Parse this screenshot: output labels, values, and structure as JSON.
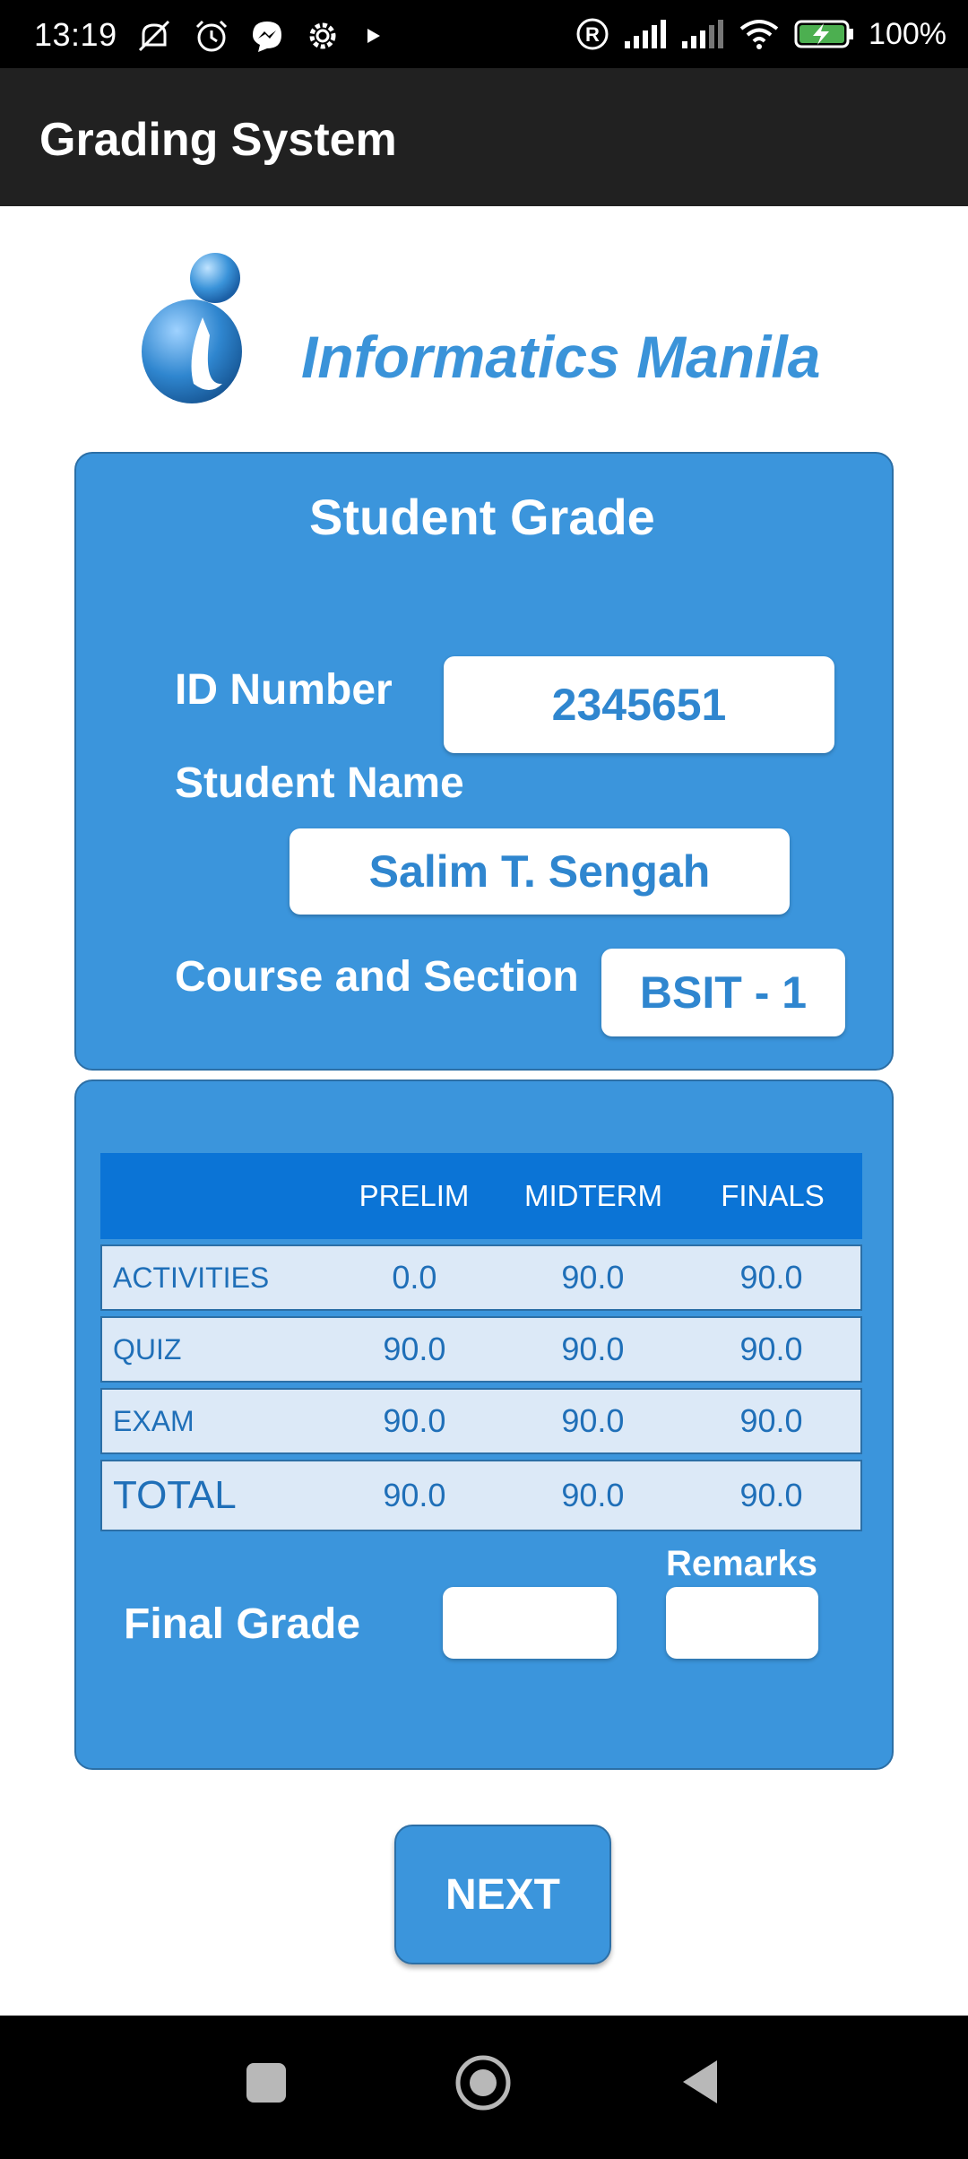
{
  "status_bar": {
    "time": "13:19",
    "battery": "100%",
    "left_icons": [
      "muted-notification-icon",
      "alarm-icon",
      "messenger-icon",
      "settings-icon",
      "play-icon"
    ],
    "right_icons": [
      "registered-icon",
      "signal-icon",
      "signal-icon",
      "wifi-icon",
      "battery-charging-icon"
    ]
  },
  "app_bar": {
    "title": "Grading System"
  },
  "logo": {
    "text": "Informatics Manila",
    "icon": "informatics-logo-icon"
  },
  "student_panel": {
    "heading": "Student Grade",
    "id_label": "ID Number",
    "id_value": "2345651",
    "name_label": "Student Name",
    "name_value": "Salim T. Sengah",
    "course_label": "Course and Section",
    "course_value": "BSIT - 1"
  },
  "grades_panel": {
    "columns": [
      "",
      "PRELIM",
      "MIDTERM",
      "FINALS"
    ],
    "rows": [
      {
        "label": "ACTIVITIES",
        "values": [
          "0.0",
          "90.0",
          "90.0"
        ]
      },
      {
        "label": "QUIZ",
        "values": [
          "90.0",
          "90.0",
          "90.0"
        ]
      },
      {
        "label": "EXAM",
        "values": [
          "90.0",
          "90.0",
          "90.0"
        ]
      },
      {
        "label": "TOTAL",
        "values": [
          "90.0",
          "90.0",
          "90.0"
        ]
      }
    ],
    "final_grade_label": "Final Grade",
    "final_grade_value": "",
    "remarks_label": "Remarks",
    "remarks_value": ""
  },
  "next_button": {
    "label": "NEXT"
  },
  "nav_bar": {
    "icons": [
      "recents-square-icon",
      "home-circle-icon",
      "back-triangle-icon"
    ]
  },
  "colors": {
    "accent": "#3b95dc",
    "header": "#0b74d6",
    "appbar": "#212121"
  }
}
